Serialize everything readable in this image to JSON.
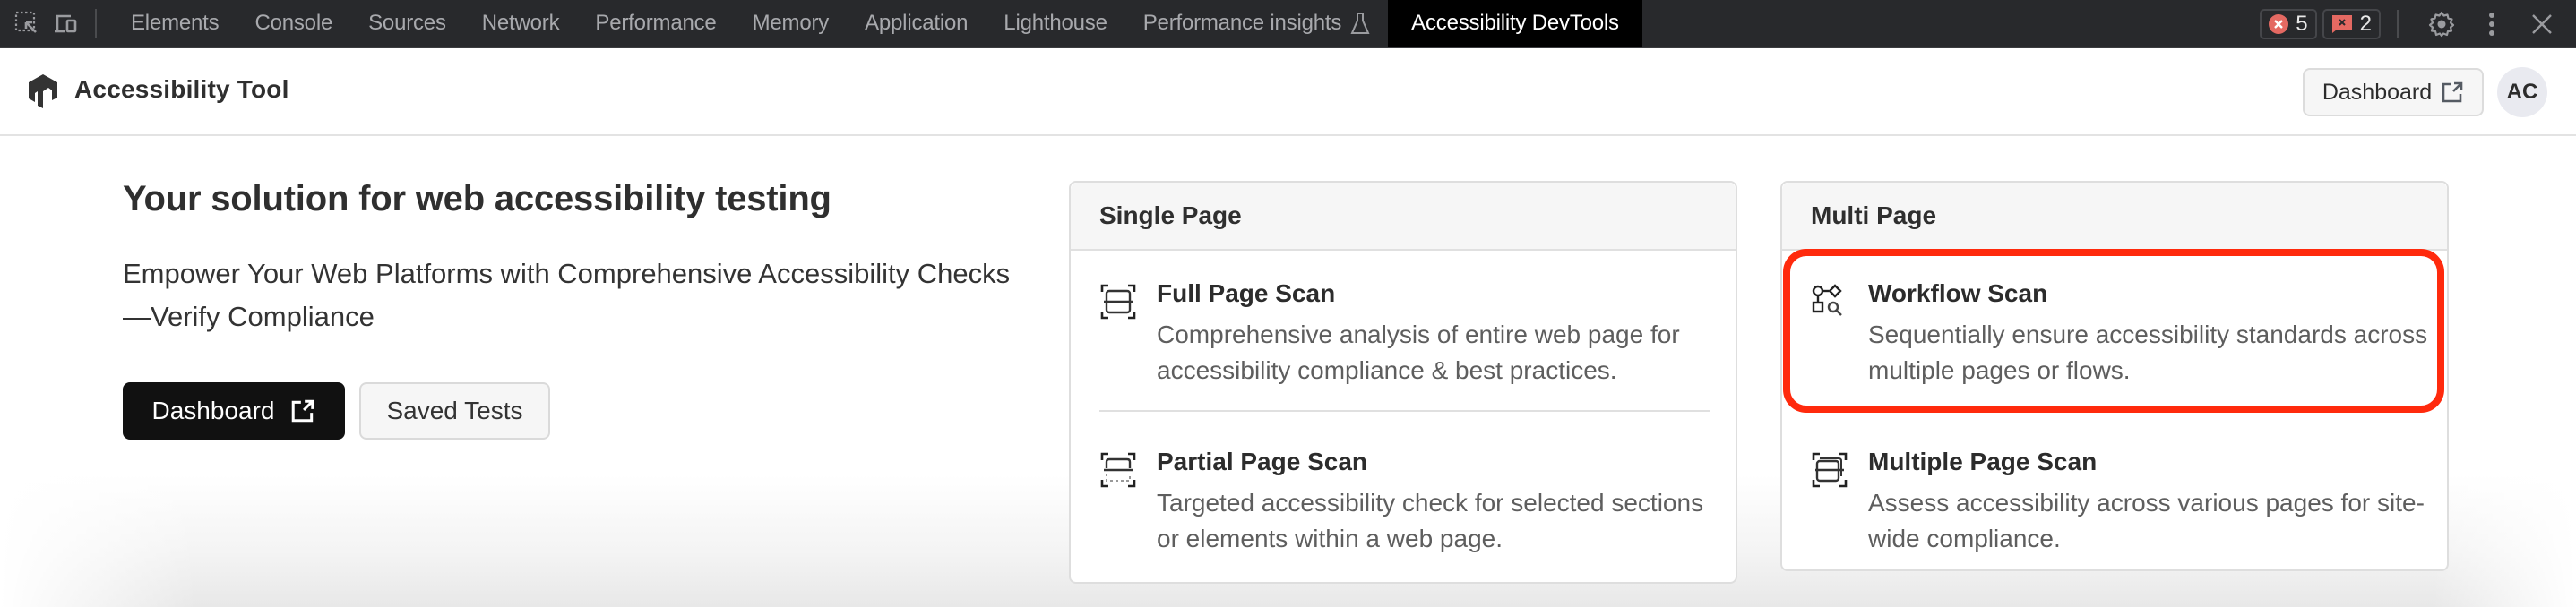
{
  "devtools": {
    "tabs": [
      {
        "label": "Elements",
        "active": false
      },
      {
        "label": "Console",
        "active": false
      },
      {
        "label": "Sources",
        "active": false
      },
      {
        "label": "Network",
        "active": false
      },
      {
        "label": "Performance",
        "active": false
      },
      {
        "label": "Memory",
        "active": false
      },
      {
        "label": "Application",
        "active": false
      },
      {
        "label": "Lighthouse",
        "active": false
      },
      {
        "label": "Performance insights",
        "active": false,
        "icon": "flask-icon"
      },
      {
        "label": "Accessibility DevTools",
        "active": true
      }
    ],
    "left_icons": [
      "inspect-element-icon",
      "device-toolbar-icon"
    ],
    "error_count": "5",
    "issue_count": "2",
    "right_icons": [
      "gear-icon",
      "more-vertical-icon",
      "close-icon"
    ],
    "colors": {
      "bar_bg": "#28292c",
      "active_tab_bg": "#000000",
      "error_red": "#e46962"
    }
  },
  "header": {
    "app_title": "Accessibility Tool",
    "logo_icon": "hexagon-arrow-logo-icon",
    "dashboard_label": "Dashboard",
    "dashboard_icon": "external-link-icon",
    "avatar_initials": "AC"
  },
  "hero": {
    "title": "Your solution for web accessibility testing",
    "subtitle": "Empower Your Web Platforms with Comprehensive Accessibility Checks—Verify Compliance",
    "primary_button": "Dashboard",
    "primary_button_icon": "external-link-icon",
    "secondary_button": "Saved Tests"
  },
  "cards": {
    "single": {
      "title": "Single Page",
      "items": [
        {
          "title": "Full Page Scan",
          "description": "Comprehensive analysis of entire web page for accessibility compliance & best practices.",
          "icon": "full-page-scan-icon"
        },
        {
          "title": "Partial Page Scan",
          "description": "Targeted accessibility check for selected sections or elements within a web page.",
          "icon": "partial-page-scan-icon"
        }
      ]
    },
    "multi": {
      "title": "Multi Page",
      "items": [
        {
          "title": "Workflow Scan",
          "description": "Sequentially ensure accessibility standards across multiple pages or flows.",
          "icon": "workflow-scan-icon",
          "highlighted": true
        },
        {
          "title": "Multiple Page Scan",
          "description": "Assess accessibility across various pages for site-wide compliance.",
          "icon": "multiple-page-scan-icon"
        }
      ]
    }
  },
  "annotation": {
    "highlight_color": "#ff2a0d",
    "target": "Workflow Scan"
  }
}
